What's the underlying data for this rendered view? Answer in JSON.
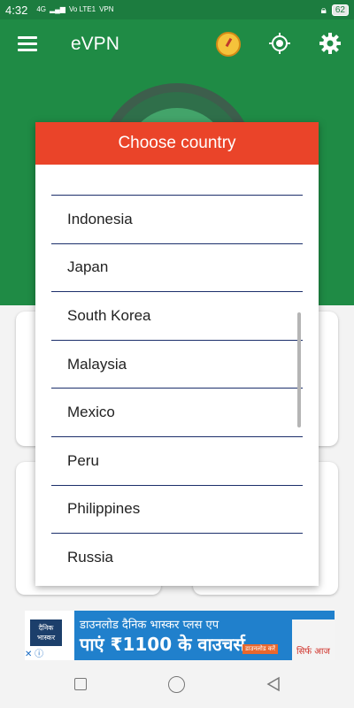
{
  "status_bar": {
    "time": "4:32",
    "network": "Vo LTE1",
    "wifi": "4G",
    "vpn_label": "VPN",
    "battery": "62"
  },
  "app_bar": {
    "title": "eVPN"
  },
  "dialog": {
    "title": "Choose country",
    "countries": [
      "Indonesia",
      "Japan",
      "South Korea",
      "Malaysia",
      "Mexico",
      "Peru",
      "Philippines",
      "Russia"
    ]
  },
  "ad": {
    "logo_text": "दैनिक भास्कर",
    "line1": "डाउनलोड दैनिक भास्कर प्लस एप",
    "line2": "पाएं ₹1100 के वाउचर्स",
    "small_button": "डाउनलोड करें",
    "corner_text": "सिर्फ आज"
  },
  "colors": {
    "primary": "#1f8b45",
    "dialog_header": "#ea4429",
    "divider": "#1c2f6b"
  }
}
